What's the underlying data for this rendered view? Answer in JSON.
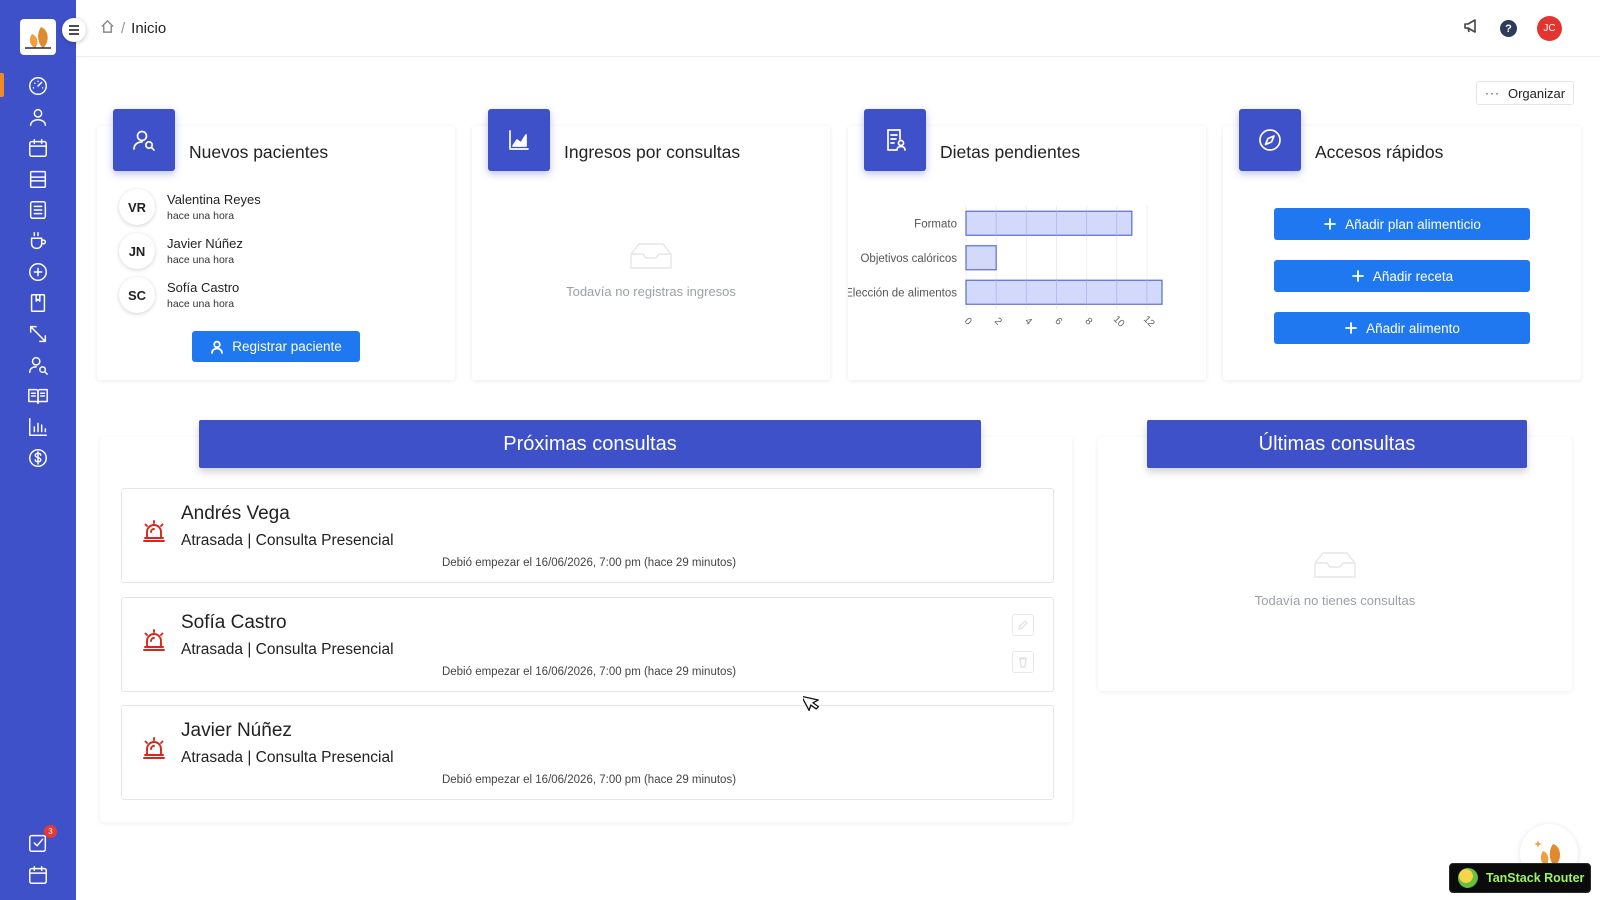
{
  "breadcrumb": {
    "current": "Inicio",
    "separator": "/"
  },
  "sidebar": {
    "active_index": 0,
    "items": [
      {
        "icon": "dashboard-gauge-icon",
        "label": "Inicio"
      },
      {
        "icon": "user-icon"
      },
      {
        "icon": "calendar-icon"
      },
      {
        "icon": "storefront-icon"
      },
      {
        "icon": "list-icon"
      },
      {
        "icon": "coffee-cup-icon"
      },
      {
        "icon": "plus-circle-icon"
      },
      {
        "icon": "bookmark-book-icon"
      },
      {
        "icon": "resize-arrows-icon"
      },
      {
        "icon": "user-search-icon"
      },
      {
        "icon": "open-book-icon"
      },
      {
        "icon": "bar-chart-icon"
      },
      {
        "icon": "dollar-circle-icon"
      }
    ],
    "bottom": [
      {
        "icon": "tasks-checkbox-icon",
        "badge": "3"
      },
      {
        "icon": "calendar-icon"
      }
    ]
  },
  "topbar": {
    "user_initials": "JC",
    "help_symbol": "?",
    "avatar_color": "#e3342f"
  },
  "organize": {
    "label": "Organizar",
    "dots": "···"
  },
  "cards": {
    "new_patients": {
      "title": "Nuevos pacientes",
      "patients": [
        {
          "initials": "VR",
          "name": "Valentina Reyes",
          "time": "hace una hora"
        },
        {
          "initials": "JN",
          "name": "Javier Núñez",
          "time": "hace una hora"
        },
        {
          "initials": "SC",
          "name": "Sofía Castro",
          "time": "hace una hora"
        }
      ],
      "register_button": "Registrar paciente"
    },
    "income": {
      "title": "Ingresos por consultas",
      "empty_text": "Todavía no registras ingresos"
    },
    "pending_diets": {
      "title": "Dietas pendientes"
    },
    "quick_access": {
      "title": "Accesos rápidos",
      "buttons": [
        "Añadir plan alimenticio",
        "Añadir receta",
        "Añadir alimento"
      ]
    }
  },
  "chart_data": {
    "type": "bar",
    "orientation": "horizontal",
    "categories": [
      "Formato",
      "Objetivos calóricos",
      "Elección de alimentos"
    ],
    "values": [
      11,
      2,
      13
    ],
    "xlim": [
      0,
      13
    ],
    "xticks": [
      "0",
      "2",
      "4",
      "6",
      "8",
      "10",
      "12"
    ],
    "grid": true,
    "bar_fill": "#d3d9fb",
    "bar_stroke": "#5b6bd6"
  },
  "upcoming": {
    "title": "Próximas consultas",
    "items": [
      {
        "name": "Andrés Vega",
        "status": "Atrasada | Consulta Presencial",
        "when": "Debió empezar el 16/06/2026, 7:00 pm (hace 29 minutos)"
      },
      {
        "name": "Sofía Castro",
        "status": "Atrasada | Consulta Presencial",
        "when": "Debió empezar el 16/06/2026, 7:00 pm (hace 29 minutos)"
      },
      {
        "name": "Javier Núñez",
        "status": "Atrasada | Consulta Presencial",
        "when": "Debió empezar el 16/06/2026, 7:00 pm (hace 29 minutos)"
      }
    ]
  },
  "last": {
    "title": "Últimas consultas",
    "empty_text": "Todavía no tienes consultas"
  },
  "devtools": {
    "label": "TanStack Router"
  },
  "colors": {
    "sidebar": "#3f51c9",
    "primary_button": "#1f78f0",
    "alert": "#d9261c",
    "active_indicator": "#f08a24"
  }
}
